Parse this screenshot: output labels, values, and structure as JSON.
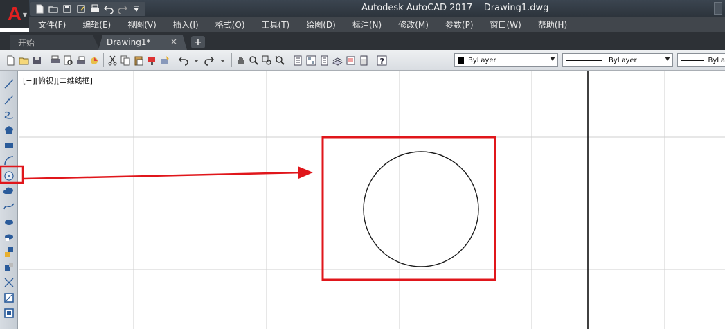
{
  "title_bar": {
    "title": "Autodesk AutoCAD 2017    Drawing1.dwg",
    "logo_letter": "A",
    "quick_access_icons": [
      "new-icon",
      "open-icon",
      "save-icon",
      "save-as-icon",
      "print-icon",
      "undo-icon",
      "redo-icon",
      "customize-icon"
    ]
  },
  "menu": {
    "items": [
      "文件(F)",
      "编辑(E)",
      "视图(V)",
      "插入(I)",
      "格式(O)",
      "工具(T)",
      "绘图(D)",
      "标注(N)",
      "修改(M)",
      "参数(P)",
      "窗口(W)",
      "帮助(H)"
    ]
  },
  "tabs": {
    "start": "开始",
    "drawing": "Drawing1*",
    "close_glyph": "×",
    "add_glyph": "+"
  },
  "toolbar": {
    "color_dropdown": "ByLayer",
    "linetype_dropdown": "ByLayer",
    "lineweight_dropdown": "ByLa"
  },
  "palette": {
    "tools": [
      "line-icon",
      "construction-line-icon",
      "polyline-icon",
      "polygon-icon",
      "rectangle-icon",
      "arc-icon",
      "circle-icon",
      "revision-cloud-icon",
      "spline-icon",
      "ellipse-icon",
      "ellipse-arc-icon",
      "insert-block-icon",
      "make-block-icon",
      "point-icon",
      "hatch-icon",
      "gradient-icon"
    ]
  },
  "canvas": {
    "view_label": "[−][俯视][二维线框]",
    "annotation_color": "#e0161b",
    "circle_color": "#1a1a1a",
    "grid_color": "#cfcfcf"
  }
}
